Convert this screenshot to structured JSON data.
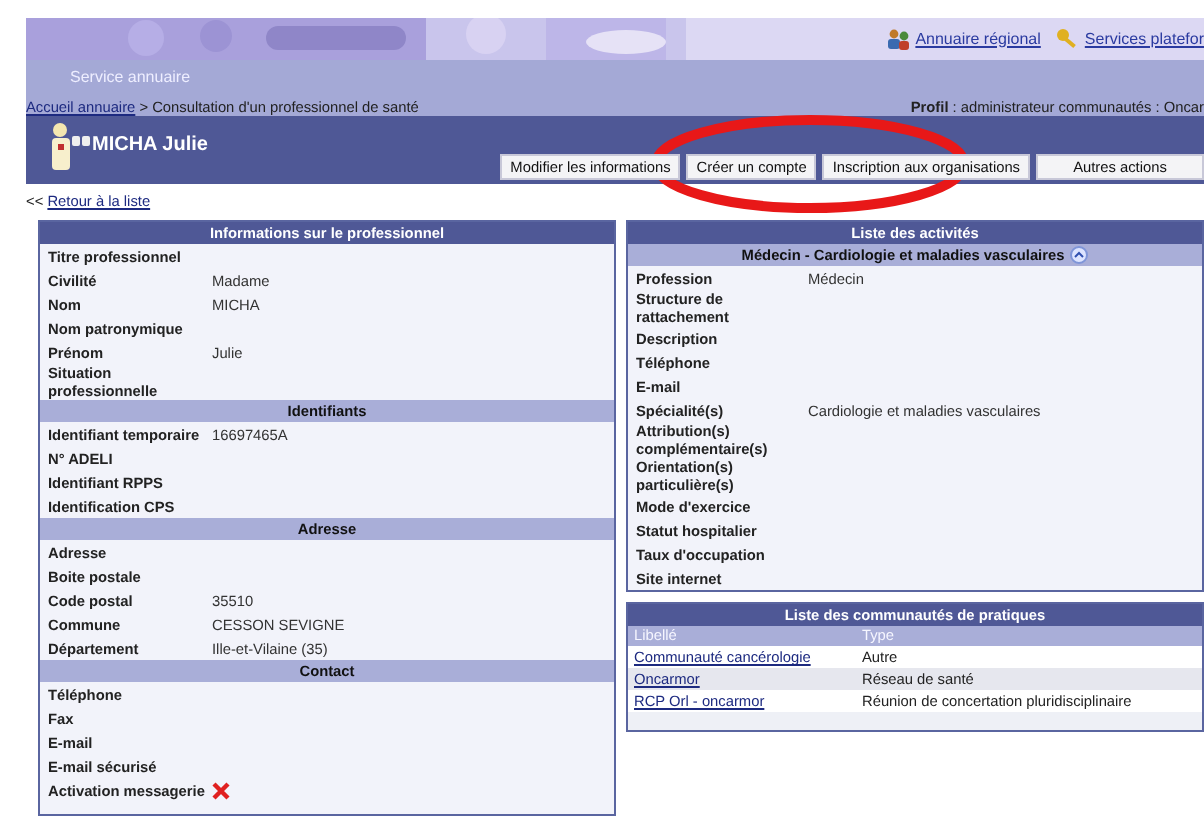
{
  "banner": {
    "links": [
      {
        "kind": "people",
        "label": "Annuaire régional"
      },
      {
        "kind": "key",
        "label": "Services platefor"
      }
    ]
  },
  "service_title": "Service annuaire",
  "breadcrumb": {
    "home": "Accueil annuaire",
    "rest": "> Consultation d'un professionnel de santé"
  },
  "profile": {
    "label": "Profil",
    "value": ": administrateur communautés : Oncar"
  },
  "person": {
    "name": "MICHA Julie"
  },
  "actions": [
    "Modifier les informations",
    "Créer un compte",
    "Inscription aux organisations",
    "Autres actions"
  ],
  "back_link": {
    "arrows": "<<",
    "label": "Retour à la liste"
  },
  "left_panel": {
    "sections": [
      {
        "kind": "main",
        "title": "Informations sur le professionnel",
        "fields": [
          {
            "label": "Titre professionnel"
          },
          {
            "label": "Civilité",
            "value": "Madame"
          },
          {
            "label": "Nom",
            "value": "MICHA"
          },
          {
            "label": "Nom patronymique"
          },
          {
            "label": "Prénom",
            "value": "Julie"
          },
          {
            "label": "Situation professionnelle"
          }
        ]
      },
      {
        "kind": "sub",
        "title": "Identifiants",
        "fields": [
          {
            "label": "Identifiant temporaire",
            "value": "16697465A"
          },
          {
            "label": "N° ADELI"
          },
          {
            "label": "Identifiant RPPS"
          },
          {
            "label": "Identification CPS"
          }
        ]
      },
      {
        "kind": "sub",
        "title": "Adresse",
        "fields": [
          {
            "label": "Adresse"
          },
          {
            "label": "Boite postale"
          },
          {
            "label": "Code postal",
            "value": "35510"
          },
          {
            "label": "Commune",
            "value": "CESSON SEVIGNE"
          },
          {
            "label": "Département",
            "value": "Ille-et-Vilaine (35)"
          }
        ]
      },
      {
        "kind": "sub",
        "title": "Contact",
        "fields": [
          {
            "label": "Téléphone"
          },
          {
            "label": "Fax"
          },
          {
            "label": "E-mail"
          },
          {
            "label": "E-mail sécurisé"
          },
          {
            "label": "Activation messagerie",
            "kind": "flag",
            "on": false
          }
        ]
      }
    ]
  },
  "activities": {
    "title": "Liste des activités",
    "items": [
      {
        "title": "Médecin - Cardiologie et maladies vasculaires",
        "expanded": true,
        "fields": [
          {
            "label": "Profession",
            "value": "Médecin"
          },
          {
            "label": "Structure de rattachement"
          },
          {
            "label": "Description"
          },
          {
            "label": "Téléphone"
          },
          {
            "label": "E-mail"
          },
          {
            "label": "Spécialité(s)",
            "value": "Cardiologie et maladies vasculaires"
          },
          {
            "label": "Attribution(s) complémentaire(s)"
          },
          {
            "label": "Orientation(s) particulière(s)"
          },
          {
            "label": "Mode d'exercice"
          },
          {
            "label": "Statut hospitalier"
          },
          {
            "label": "Taux d'occupation"
          },
          {
            "label": "Site internet"
          }
        ]
      }
    ]
  },
  "communities": {
    "title": "Liste des communautés de pratiques",
    "columns": [
      "Libellé",
      "Type"
    ],
    "rows": [
      {
        "label": "Communauté cancérologie",
        "type": "Autre"
      },
      {
        "label": "Oncarmor",
        "type": "Réseau de santé"
      },
      {
        "label": "RCP Orl - oncarmor",
        "type": "Réunion de concertation pluridisciplinaire"
      }
    ]
  }
}
